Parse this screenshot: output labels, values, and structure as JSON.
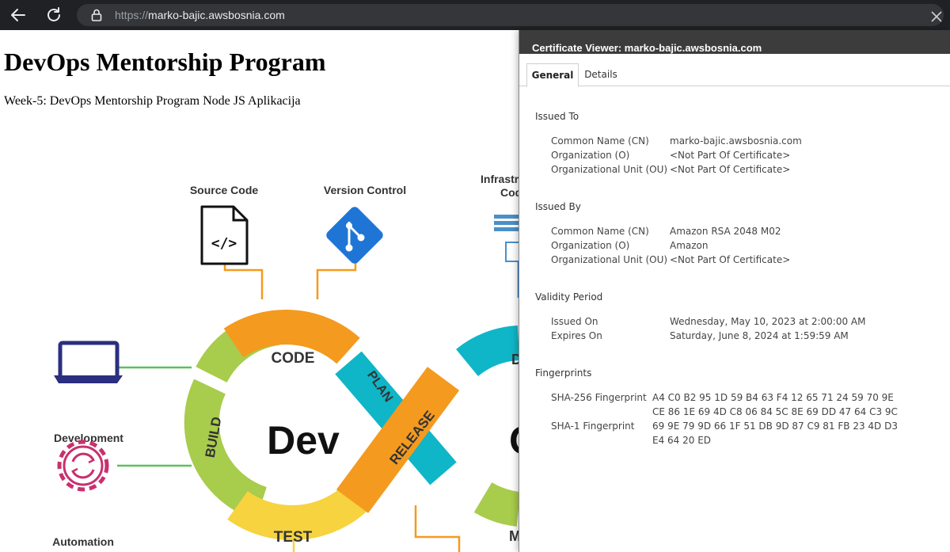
{
  "browser": {
    "url_protocol": "https://",
    "url_host": "marko-bajic.awsbosnia.com"
  },
  "page": {
    "heading": "DevOps Mentorship Program",
    "subtitle": "Week-5: DevOps Mentorship Program Node JS Aplikacija",
    "diagram": {
      "labels": {
        "source_code": "Source Code",
        "version_control": "Version Control",
        "infra_line1": "Infrastr",
        "infra_line2": "Cod",
        "development": "Development",
        "automation": "Automation"
      },
      "loop_labels": {
        "code": "CODE",
        "plan": "PLAN",
        "build": "BUILD",
        "test": "TEST",
        "release": "RELEASE",
        "right_top": "D",
        "right_bottom": "M",
        "center": "Dev",
        "center_right": "O"
      },
      "colors": {
        "orange": "#f49a1f",
        "teal": "#0fb6c8",
        "green": "#a8cc4c",
        "yellow": "#f6d33f",
        "navy": "#2b2f80",
        "magenta": "#c8306e",
        "git_blue": "#1f75d6"
      }
    }
  },
  "cert": {
    "title": "Certificate Viewer: marko-bajic.awsbosnia.com",
    "tabs": [
      "General",
      "Details"
    ],
    "issued_to": {
      "title": "Issued To",
      "rows": [
        {
          "label": "Common Name (CN)",
          "value": "marko-bajic.awsbosnia.com"
        },
        {
          "label": "Organization (O)",
          "value": "<Not Part Of Certificate>"
        },
        {
          "label": "Organizational Unit (OU)",
          "value": "<Not Part Of Certificate>"
        }
      ]
    },
    "issued_by": {
      "title": "Issued By",
      "rows": [
        {
          "label": "Common Name (CN)",
          "value": "Amazon RSA 2048 M02"
        },
        {
          "label": "Organization (O)",
          "value": "Amazon"
        },
        {
          "label": "Organizational Unit (OU)",
          "value": "<Not Part Of Certificate>"
        }
      ]
    },
    "validity": {
      "title": "Validity Period",
      "rows": [
        {
          "label": "Issued On",
          "value": "Wednesday, May 10, 2023 at 2:00:00 AM"
        },
        {
          "label": "Expires On",
          "value": "Saturday, June 8, 2024 at 1:59:59 AM"
        }
      ]
    },
    "fingerprints": {
      "title": "Fingerprints",
      "sha256_label": "SHA-256 Fingerprint",
      "sha256_line1": "A4 C0 B2 95 1D 59 B4 63 F4 12 65 71 24 59 70 9E",
      "sha256_line2": "CE 86 1E 69 4D C8 06 84 5C 8E 69 DD 47 64 C3 9C",
      "sha1_label": "SHA-1 Fingerprint",
      "sha1_line1": "69 9E 79 9D 66 1F 51 DB 9D 87 C9 81 FB 23 4D D3",
      "sha1_line2": "E4 64 20 ED"
    }
  }
}
